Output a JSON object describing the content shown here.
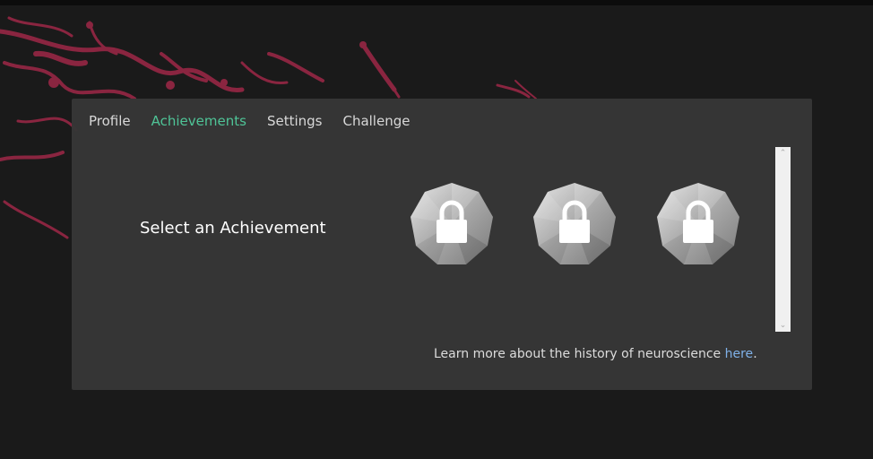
{
  "nav": {
    "tabs": [
      {
        "label": "Profile"
      },
      {
        "label": "Achievements",
        "active": true
      },
      {
        "label": "Settings"
      },
      {
        "label": "Challenge"
      }
    ]
  },
  "achievements": {
    "title": "Select an Achievement",
    "badges": [
      {
        "state": "locked",
        "icon": "lock-icon"
      },
      {
        "state": "locked",
        "icon": "lock-icon"
      },
      {
        "state": "locked",
        "icon": "lock-icon"
      }
    ]
  },
  "footer": {
    "text": "Learn more about the history of neuroscience ",
    "link_label": "here",
    "suffix": "."
  },
  "colors": {
    "active_tab": "#4fc497",
    "link": "#7fb1e8",
    "neuron": "#8a2540"
  }
}
